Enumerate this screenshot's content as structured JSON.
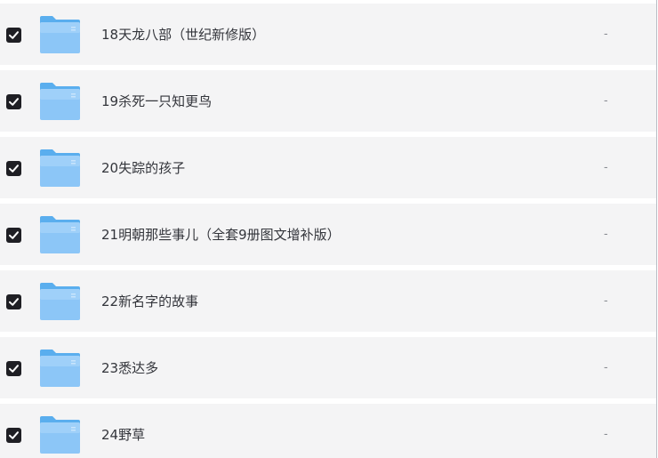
{
  "files": [
    {
      "name": "18天龙八部（世纪新修版）",
      "size": "-",
      "checked": true,
      "icon": "folder-icon"
    },
    {
      "name": "19杀死一只知更鸟",
      "size": "-",
      "checked": true,
      "icon": "folder-icon"
    },
    {
      "name": "20失踪的孩子",
      "size": "-",
      "checked": true,
      "icon": "folder-icon"
    },
    {
      "name": "21明朝那些事儿（全套9册图文增补版）",
      "size": "-",
      "checked": true,
      "icon": "folder-icon"
    },
    {
      "name": "22新名字的故事",
      "size": "-",
      "checked": true,
      "icon": "folder-icon"
    },
    {
      "name": "23悉达多",
      "size": "-",
      "checked": true,
      "icon": "folder-icon"
    },
    {
      "name": "24野草",
      "size": "-",
      "checked": true,
      "icon": "folder-icon"
    }
  ],
  "colors": {
    "row_background": "#f4f4f5",
    "checkbox_fill": "#1f1f24",
    "folder_blue": "#8cc6f7"
  }
}
